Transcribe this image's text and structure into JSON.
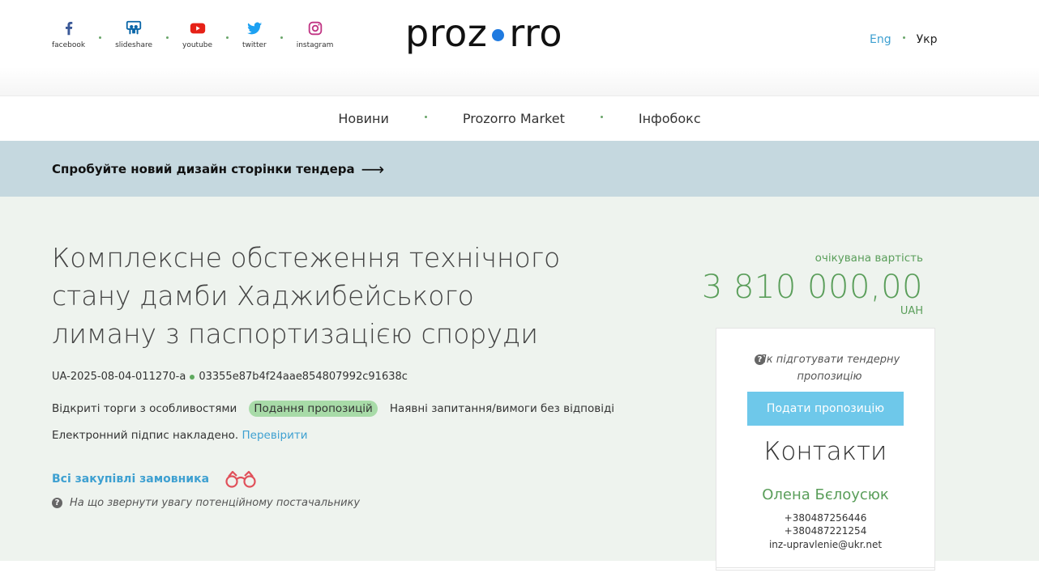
{
  "header": {
    "socials": [
      {
        "label": "facebook",
        "icon": "facebook-icon",
        "color": "#3b5998"
      },
      {
        "label": "slideshare",
        "icon": "slideshare-icon",
        "color": "#0077b5"
      },
      {
        "label": "youtube",
        "icon": "youtube-icon",
        "color": "#e62117"
      },
      {
        "label": "twitter",
        "icon": "twitter-icon",
        "color": "#1da1f2"
      },
      {
        "label": "instagram",
        "icon": "instagram-icon",
        "color": "#c13584"
      }
    ],
    "logo_left": "proz",
    "logo_right": "rro",
    "lang_eng": "Eng",
    "lang_ukr": "Укр"
  },
  "nav": {
    "items": [
      "Новини",
      "Prozorro Market",
      "Інфобокс"
    ]
  },
  "banner": {
    "text": "Спробуйте новий дизайн сторінки тендера",
    "arrow": "⟶"
  },
  "tender": {
    "title": "Комплексне обстеження технічного стану дамби Хаджибейського лиману з паспортизацією споруди",
    "id": "UA-2025-08-04-011270-a",
    "hash": "03355e87b4f24aae854807992c91638c",
    "procedure": "Відкриті торги з особливостями",
    "status": "Подання пропозицій",
    "questions": "Наявні запитання/вимоги без відповіді",
    "signature_text": "Електронний підпис накладено.",
    "signature_link": "Перевірити",
    "all_purchases": "Всі закупівлі замовника",
    "hint": "На що звернути увагу потенційному постачальнику"
  },
  "price": {
    "label": "очікувана вартість",
    "value": "3 810 000,00",
    "currency": "UAH"
  },
  "panel": {
    "prep_hint": "Як підготувати тендерну пропозицію",
    "submit_label": "Подати пропозицію",
    "contacts_title": "Контакти",
    "contact_name": "Олена Бєлоусюк",
    "phone1": "+380487256446",
    "phone2": "+380487221254",
    "email": "inz-upravlenie@ukr.net"
  },
  "colors": {
    "accent_green": "#5a9e5a",
    "link_blue": "#3ea0d1",
    "banner_bg": "#c5d8df",
    "main_bg": "#eef3ee",
    "submit_bg": "#6ec8ea"
  }
}
